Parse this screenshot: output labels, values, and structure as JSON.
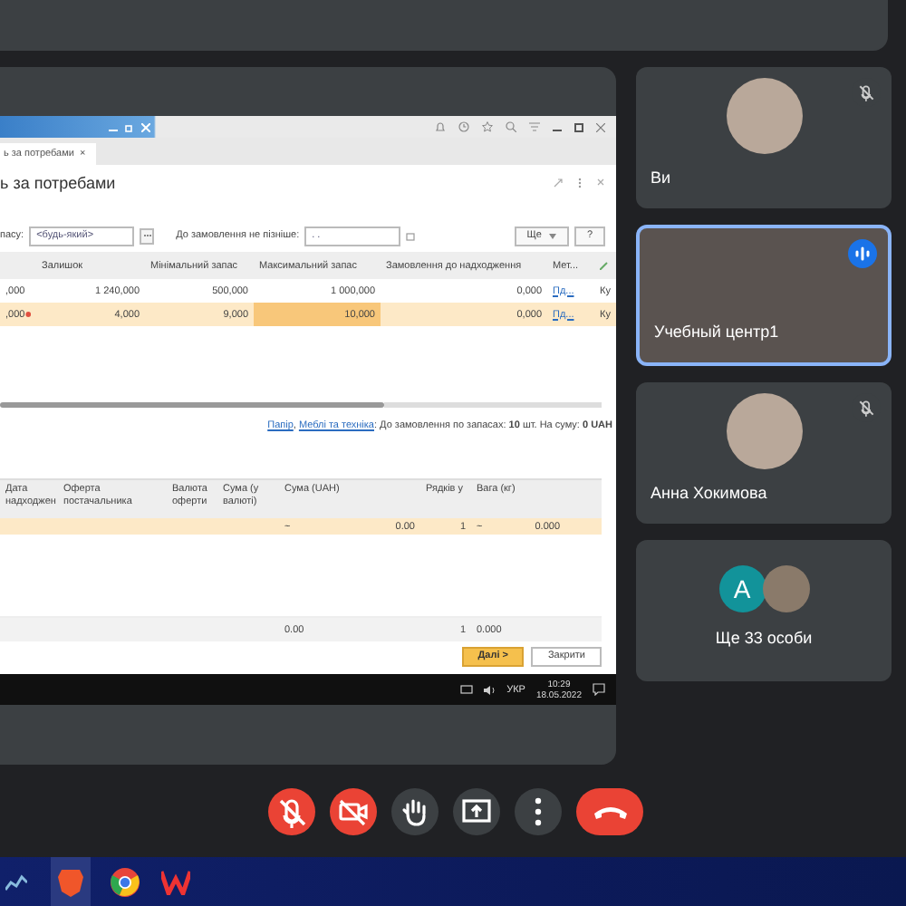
{
  "shared_screen": {
    "tab": {
      "label": "ь за потребами",
      "close": "×"
    },
    "title": "ь за потребами",
    "filters": [
      {
        "label": "пасу:",
        "value": "<будь-який>",
        "kind": "select"
      },
      {
        "label": "До замовлення не пізніше:",
        "value": ". .",
        "kind": "date"
      }
    ],
    "tool_buttons": [
      "Ще",
      "?"
    ],
    "columns": [
      "Залишок",
      "Мінімальний запас",
      "Максимальний запас",
      "Замовлення до надходження",
      "Мет..."
    ],
    "rows": [
      {
        "selected": false,
        "warning": false,
        "cells": [
          ",000",
          "1 240,000",
          "500,000",
          "1 000,000",
          "0,000"
        ],
        "link": "Пд...",
        "column_7": "Ку"
      },
      {
        "selected": true,
        "warning": true,
        "cells": [
          ",000",
          "4,000",
          "9,000",
          "10,000",
          "0,000"
        ],
        "link": "Пд...",
        "column_7": "Ку"
      }
    ],
    "summary": {
      "links": [
        "Папір",
        "Меблі та техніка"
      ],
      "separator": ",",
      "text": ": До замовлення по запасах: **10** шт. На суму: **0 UAH**"
    },
    "lower_columns": [
      "Дата надходжен",
      "Оферта постачальника",
      "Валюта оферти",
      "Сума (у валюті)",
      "Сума (UAH)",
      "Рядків у",
      "Вага (кг)"
    ],
    "lower_row": [
      "~",
      "0.00",
      "1",
      "~",
      "0.000"
    ],
    "totals": [
      "0.00",
      "1",
      "0.000"
    ],
    "buttons": [
      {
        "label": "Далі >",
        "kind": "primary"
      },
      {
        "label": "Закрити",
        "kind": "default"
      }
    ],
    "taskbar": {
      "language": "УКР",
      "time": "10:29",
      "date": "18.05.2022"
    }
  },
  "participants": [
    {
      "name": "Ви",
      "kind": "avatar",
      "muted": true,
      "speaking": false
    },
    {
      "name": "Учебный центр1",
      "kind": "video",
      "muted": false,
      "speaking": true
    },
    {
      "name": "Анна Хокимова",
      "kind": "avatar",
      "muted": true,
      "speaking": false
    }
  ],
  "others": {
    "initial": "A",
    "label": "Ще 33 особи"
  },
  "controls": [
    {
      "kind": "mic",
      "on": false
    },
    {
      "kind": "camera",
      "on": false
    },
    {
      "kind": "hand"
    },
    {
      "kind": "present"
    },
    {
      "kind": "more"
    },
    {
      "kind": "leave"
    }
  ]
}
